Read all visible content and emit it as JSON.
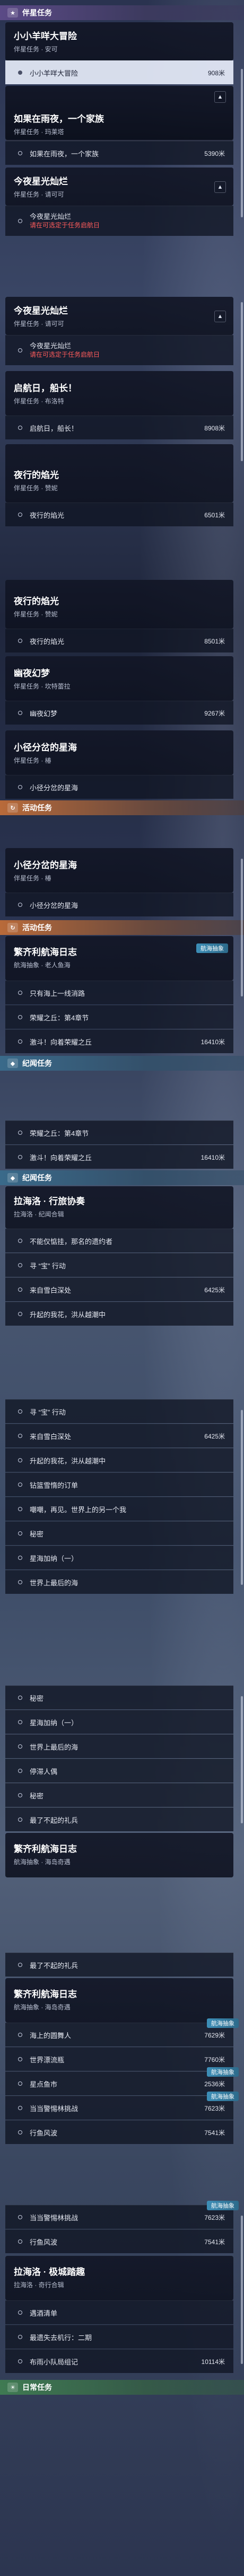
{
  "sections": {
    "companion": "伴星任务",
    "event1": "活动任务",
    "event2": "活动任务",
    "memory1": "纪闻任务",
    "memory2": "纪闻任务",
    "daily": "日常任务"
  },
  "cards": {
    "c1": {
      "title": "小小羊咩大冒险",
      "sub": "伴星任务 · 安可"
    },
    "c2": {
      "title": "如果在雨夜，一个家族",
      "sub": "伴星任务 · 玛莱塔"
    },
    "c3": {
      "title": "今夜星光灿烂",
      "sub": "伴星任务 · 请可可"
    },
    "c4": {
      "title": "今夜星光灿烂",
      "sub": "伴星任务 · 请可可"
    },
    "c5": {
      "title": "启航日，船长！",
      "sub": "伴星任务 · 布洛特"
    },
    "c6": {
      "title": "夜行的焰光",
      "sub": "伴星任务 · 赞妮"
    },
    "c7": {
      "title": "夜行的焰光",
      "sub": "伴星任务 · 赞妮"
    },
    "c8": {
      "title": "幽夜幻梦",
      "sub": "伴星任务 · 坎特蕾拉"
    },
    "c9": {
      "title": "小径分岔的星海",
      "sub": "伴星任务 · 椿"
    },
    "c10": {
      "title": "小径分岔的星海",
      "sub": "伴星任务 · 椿"
    },
    "c11": {
      "title": "繁齐利航海日志",
      "sub": "航海抽象 · 老人鱼海"
    },
    "c12": {
      "title": "拉海洛 · 行旅协奏",
      "sub": "拉海洛 · 纪闻合辑"
    },
    "c13": {
      "title": "繁齐利航海日志",
      "sub": "航海抽象 · 海岛奇遇"
    },
    "c14": {
      "title": "繁齐利航海日志",
      "sub": "航海抽象 · 海岛奇遇"
    },
    "c15": {
      "title": "拉海洛 · 极城踏趣",
      "sub": "拉海洛 · 奇行合辑"
    }
  },
  "rows": {
    "r1": {
      "text": "小小羊咩大冒险",
      "dist": "908米"
    },
    "r2": {
      "text": "如果在雨夜，一个家族",
      "dist": "5390米"
    },
    "r3": {
      "text": "今夜星光灿烂",
      "warn": "请在可选定于任务启航日"
    },
    "r4": {
      "text": "今夜星光灿烂",
      "warn": "请在可选定于任务启航日"
    },
    "r5": {
      "text": "启航日，船长！",
      "dist": "8908米"
    },
    "r6": {
      "text": "夜行的焰光",
      "dist": "6501米"
    },
    "r7": {
      "text": "夜行的焰光",
      "dist": "8501米"
    },
    "r8": {
      "text": "幽夜幻梦",
      "dist": "9267米"
    },
    "r9": {
      "text": "小径分岔的星海"
    },
    "r10": {
      "text": "小径分岔的星海"
    },
    "r11": {
      "text": "只有海上一线消路"
    },
    "r12": {
      "text": "荣耀之丘：第4章节"
    },
    "r13": {
      "text": "激斗！向着荣耀之丘",
      "dist": "16410米"
    },
    "r14": {
      "text": "荣耀之丘：第4章节"
    },
    "r15": {
      "text": "激斗！向着荣耀之丘",
      "dist": "16410米"
    },
    "r16": {
      "text": "不能仅惦挂，那名的遗约者"
    },
    "r17": {
      "text": "寻 “宝” 行动"
    },
    "r18": {
      "text": "来自雪白深处",
      "dist": "6425米"
    },
    "r19": {
      "text": "升起的我花，洪从越潮中"
    },
    "r20": {
      "text": "寻 “宝” 行动"
    },
    "r21": {
      "text": "来自雪白深处",
      "dist": "6425米"
    },
    "r22": {
      "text": "升起的我花，洪从越潮中"
    },
    "r23": {
      "text": "钻篮雪惰的订单"
    },
    "r24": {
      "text": "嘲嘲，再见。世界上的另一个我"
    },
    "r25": {
      "text": "秘密"
    },
    "r26": {
      "text": "星海加纳（一）"
    },
    "r27": {
      "text": "世界上最后的海"
    },
    "r28": {
      "text": "秘密"
    },
    "r29": {
      "text": "星海加纳（一）"
    },
    "r30": {
      "text": "世界上最后的海"
    },
    "r31": {
      "text": "停滞人偶"
    },
    "r32": {
      "text": "秘密"
    },
    "r33": {
      "text": "最了不起的礼兵"
    },
    "r34": {
      "text": "最了不起的礼兵"
    },
    "r35": {
      "text": "海上的圆舞人",
      "dist": "7629米",
      "tag": "航海抽象"
    },
    "r36": {
      "text": "世界漂流瓶",
      "dist": "7760米"
    },
    "r37": {
      "text": "星点鱼市",
      "dist": "2536米",
      "tag": "航海抽象"
    },
    "r38": {
      "text": "当当警惕林挑战",
      "dist": "7623米",
      "tag": "航海抽象"
    },
    "r39": {
      "text": "行鱼风波",
      "dist": "7541米"
    },
    "r40": {
      "text": "当当警惕林挑战",
      "dist": "7623米",
      "tag": "航海抽象"
    },
    "r41": {
      "text": "行鱼风波",
      "dist": "7541米"
    },
    "r42": {
      "text": "遇酒清单"
    },
    "r43": {
      "text": "最遗失去机行：二期"
    },
    "r44": {
      "text": "布雨小队局组记",
      "dist": "10114米"
    }
  },
  "tags": {
    "sea": "航海抽象"
  }
}
